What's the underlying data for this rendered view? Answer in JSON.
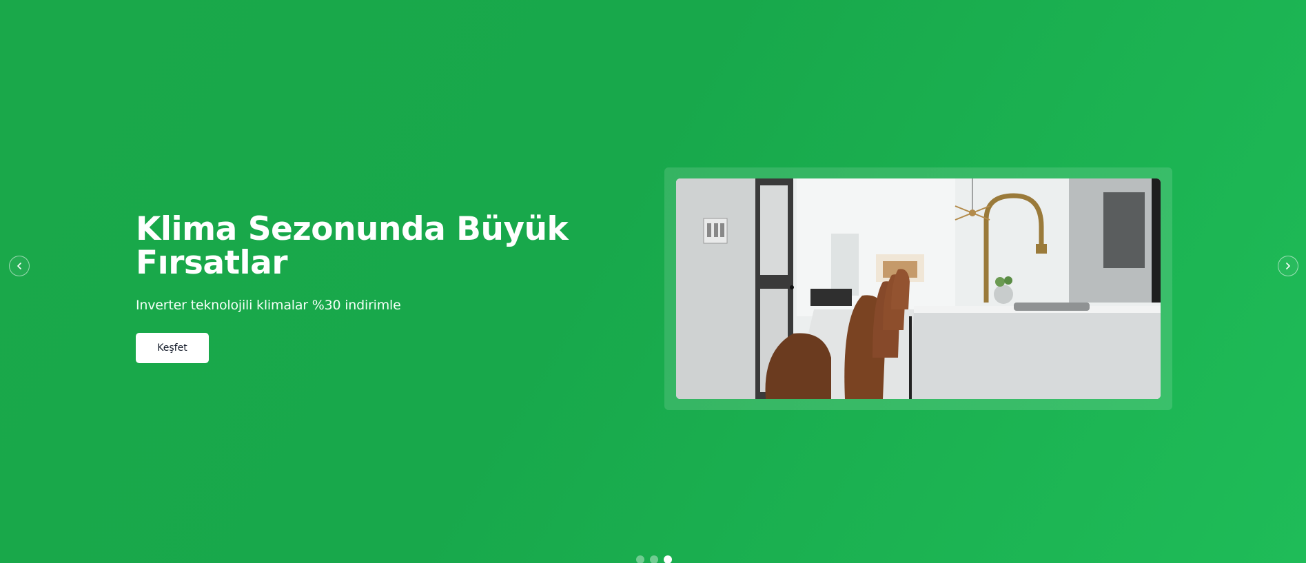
{
  "slide": {
    "title": "Klima Sezonunda Büyük Fırsatlar",
    "subtitle": "Inverter teknolojili klimalar %30 indirimle",
    "cta_label": "Keşfet"
  },
  "carousel": {
    "prev_icon": "chevron-left-icon",
    "next_icon": "chevron-right-icon",
    "slide_count": 3,
    "active_slide": 3
  },
  "colors": {
    "background": "#1aa84a",
    "accent": "#1fbc58",
    "button_bg": "#ffffff",
    "button_text": "#111827"
  }
}
